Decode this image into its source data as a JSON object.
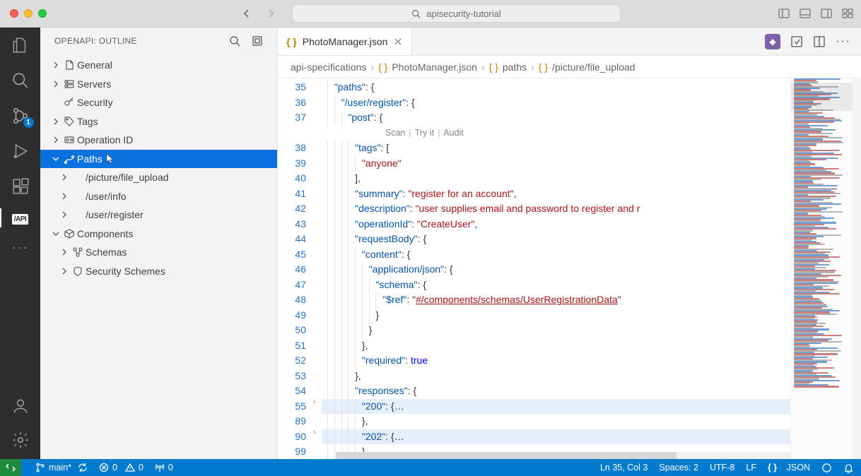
{
  "window": {
    "search_prefix_icon": "search",
    "search_text": "apisecurity-tutorial"
  },
  "activitybar": {
    "badge": "1",
    "api_label": "/API"
  },
  "sidebar": {
    "title": "OPENAPI: OUTLINE",
    "items": [
      {
        "label": "General",
        "depth": 0,
        "chev": ">",
        "icon": "doc"
      },
      {
        "label": "Servers",
        "depth": 0,
        "chev": ">",
        "icon": "servers"
      },
      {
        "label": "Security",
        "depth": 0,
        "chev": "",
        "icon": "key"
      },
      {
        "label": "Tags",
        "depth": 0,
        "chev": ">",
        "icon": "tag"
      },
      {
        "label": "Operation ID",
        "depth": 0,
        "chev": ">",
        "icon": "id"
      },
      {
        "label": "Paths",
        "depth": 0,
        "chev": "v",
        "icon": "path",
        "selected": true
      },
      {
        "label": "/picture/file_upload",
        "depth": 1,
        "chev": ">",
        "icon": ""
      },
      {
        "label": "/user/info",
        "depth": 1,
        "chev": ">",
        "icon": ""
      },
      {
        "label": "/user/register",
        "depth": 1,
        "chev": ">",
        "icon": ""
      },
      {
        "label": "Components",
        "depth": 0,
        "chev": "v",
        "icon": "box"
      },
      {
        "label": "Schemas",
        "depth": 1,
        "chev": ">",
        "icon": "schema"
      },
      {
        "label": "Security Schemes",
        "depth": 1,
        "chev": ">",
        "icon": "shield"
      }
    ]
  },
  "tab": {
    "icon": "{ }",
    "name": "PhotoManager.json"
  },
  "breadcrumb": {
    "parts": [
      "api-specifications",
      "PhotoManager.json",
      "paths",
      "/picture/file_upload"
    ],
    "icons": [
      "",
      "{ }",
      "{ }",
      "{ }"
    ]
  },
  "code": {
    "lines": [
      {
        "n": 35,
        "indent": 1,
        "tokens": [
          [
            "key",
            "\"paths\""
          ],
          [
            "punc",
            ": "
          ],
          [
            "punc",
            "{"
          ]
        ]
      },
      {
        "n": 36,
        "indent": 2,
        "tokens": [
          [
            "key",
            "\"/user/register\""
          ],
          [
            "punc",
            ": "
          ],
          [
            "punc",
            "{"
          ]
        ]
      },
      {
        "n": 37,
        "indent": 3,
        "tokens": [
          [
            "key",
            "\"post\""
          ],
          [
            "punc",
            ": "
          ],
          [
            "punc",
            "{"
          ]
        ]
      },
      {
        "codelens": true,
        "items": [
          "Scan",
          "Try it",
          "Audit"
        ]
      },
      {
        "n": 38,
        "indent": 4,
        "tokens": [
          [
            "key",
            "\"tags\""
          ],
          [
            "punc",
            ": "
          ],
          [
            "punc",
            "["
          ]
        ]
      },
      {
        "n": 39,
        "indent": 5,
        "tokens": [
          [
            "str",
            "\"anyone\""
          ]
        ]
      },
      {
        "n": 40,
        "indent": 4,
        "tokens": [
          [
            "punc",
            "],"
          ]
        ]
      },
      {
        "n": 41,
        "indent": 4,
        "tokens": [
          [
            "key",
            "\"summary\""
          ],
          [
            "punc",
            ": "
          ],
          [
            "str",
            "\"register for an account\""
          ],
          [
            "punc",
            ","
          ]
        ]
      },
      {
        "n": 42,
        "indent": 4,
        "tokens": [
          [
            "key",
            "\"description\""
          ],
          [
            "punc",
            ": "
          ],
          [
            "str",
            "\"user supplies email and password to register and r"
          ]
        ]
      },
      {
        "n": 43,
        "indent": 4,
        "tokens": [
          [
            "key",
            "\"operationId\""
          ],
          [
            "punc",
            ": "
          ],
          [
            "str",
            "\"CreateUser\""
          ],
          [
            "punc",
            ","
          ]
        ]
      },
      {
        "n": 44,
        "indent": 4,
        "tokens": [
          [
            "key",
            "\"requestBody\""
          ],
          [
            "punc",
            ": "
          ],
          [
            "punc",
            "{"
          ]
        ]
      },
      {
        "n": 45,
        "indent": 5,
        "tokens": [
          [
            "key",
            "\"content\""
          ],
          [
            "punc",
            ": "
          ],
          [
            "punc",
            "{"
          ]
        ]
      },
      {
        "n": 46,
        "indent": 6,
        "tokens": [
          [
            "key",
            "\"application/json\""
          ],
          [
            "punc",
            ": "
          ],
          [
            "punc",
            "{"
          ]
        ]
      },
      {
        "n": 47,
        "indent": 7,
        "tokens": [
          [
            "key",
            "\"schema\""
          ],
          [
            "punc",
            ": "
          ],
          [
            "punc",
            "{"
          ]
        ]
      },
      {
        "n": 48,
        "indent": 8,
        "tokens": [
          [
            "key",
            "\"$ref\""
          ],
          [
            "punc",
            ": "
          ],
          [
            "punc",
            "\""
          ],
          [
            "link",
            "#/components/schemas/UserRegistrationData"
          ],
          [
            "punc",
            "\""
          ]
        ]
      },
      {
        "n": 49,
        "indent": 7,
        "tokens": [
          [
            "punc",
            "}"
          ]
        ]
      },
      {
        "n": 50,
        "indent": 6,
        "tokens": [
          [
            "punc",
            "}"
          ]
        ]
      },
      {
        "n": 51,
        "indent": 5,
        "tokens": [
          [
            "punc",
            "},"
          ]
        ]
      },
      {
        "n": 52,
        "indent": 5,
        "tokens": [
          [
            "key",
            "\"required\""
          ],
          [
            "punc",
            ": "
          ],
          [
            "bool",
            "true"
          ]
        ]
      },
      {
        "n": 53,
        "indent": 4,
        "tokens": [
          [
            "punc",
            "},"
          ]
        ]
      },
      {
        "n": 54,
        "indent": 4,
        "tokens": [
          [
            "key",
            "\"responses\""
          ],
          [
            "punc",
            ": "
          ],
          [
            "punc",
            "{"
          ]
        ]
      },
      {
        "n": 55,
        "indent": 5,
        "hl": true,
        "fold": true,
        "tokens": [
          [
            "key",
            "\"200\""
          ],
          [
            "punc",
            ": "
          ],
          [
            "punc",
            "{"
          ],
          [
            "punc",
            "…"
          ]
        ]
      },
      {
        "n": 89,
        "indent": 5,
        "tokens": [
          [
            "punc",
            "},"
          ]
        ]
      },
      {
        "n": 90,
        "indent": 5,
        "hl": true,
        "fold": true,
        "tokens": [
          [
            "key",
            "\"202\""
          ],
          [
            "punc",
            ": "
          ],
          [
            "punc",
            "{"
          ],
          [
            "punc",
            "…"
          ]
        ]
      },
      {
        "n": 99,
        "indent": 5,
        "tokens": [
          [
            "punc",
            "},"
          ]
        ]
      }
    ]
  },
  "status": {
    "branch": "main*",
    "sync": "",
    "errors": "0",
    "warnings": "0",
    "ports": "0",
    "cursor": "Ln 35, Col 3",
    "spaces": "Spaces: 2",
    "encoding": "UTF-8",
    "eol": "LF",
    "lang_icon": "{ }",
    "lang": "JSON"
  }
}
